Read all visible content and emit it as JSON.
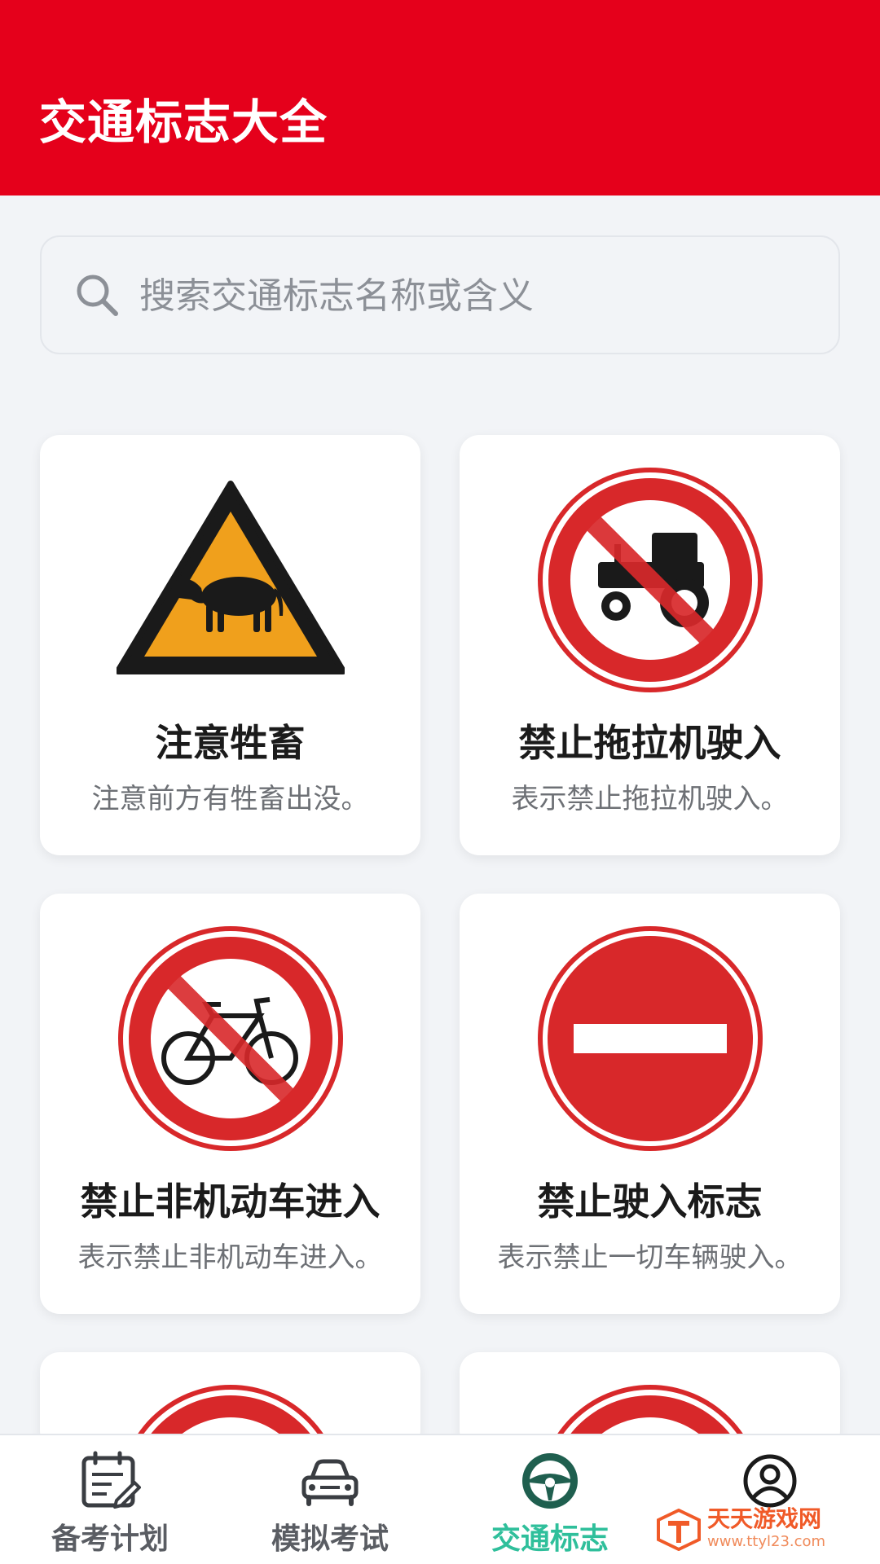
{
  "header": {
    "title": "交通标志大全"
  },
  "search": {
    "placeholder": "搜索交通标志名称或含义"
  },
  "signs": [
    {
      "title": "注意牲畜",
      "desc": "注意前方有牲畜出没。",
      "icon": "cattle-warning-sign"
    },
    {
      "title": "禁止拖拉机驶入",
      "desc": "表示禁止拖拉机驶入。",
      "icon": "no-tractor-sign"
    },
    {
      "title": "禁止非机动车进入",
      "desc": "表示禁止非机动车进入。",
      "icon": "no-bicycle-sign"
    },
    {
      "title": "禁止驶入标志",
      "desc": "表示禁止一切车辆驶入。",
      "icon": "no-entry-sign"
    }
  ],
  "tabbar": {
    "tabs": [
      {
        "label": "备考计划",
        "icon": "calendar-edit-icon",
        "active": false
      },
      {
        "label": "模拟考试",
        "icon": "car-icon",
        "active": false
      },
      {
        "label": "交通标志",
        "icon": "steering-wheel-icon",
        "active": true
      },
      {
        "label": "",
        "icon": "user-icon",
        "active": false
      }
    ]
  },
  "watermark": {
    "text": "天天游戏网",
    "url": "www.ttyl23.com"
  },
  "colors": {
    "header": "#e5001b",
    "sign_red": "#d8282a",
    "warning_yellow": "#f0a01c",
    "active_tab": "#2fbf9b",
    "background": "#f2f4f7"
  }
}
